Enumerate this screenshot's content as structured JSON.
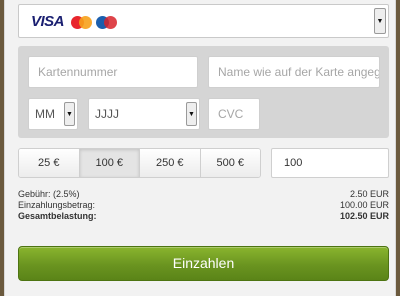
{
  "payment_method": {
    "logos": {
      "visa_text": "VISA",
      "mastercard": "mastercard-logo",
      "maestro": "maestro-logo"
    },
    "arrow_icon": "triangle-down-icon"
  },
  "card_form": {
    "card_number_placeholder": "Kartennummer",
    "card_name_placeholder": "Name wie auf der Karte angegeben",
    "month_value": "MM",
    "year_value": "JJJJ",
    "cvc_placeholder": "CVC",
    "dropdown_arrow_icon": "triangle-down-icon"
  },
  "amounts": {
    "options": [
      "25 €",
      "100 €",
      "250 €",
      "500 €"
    ],
    "selected_index": 1,
    "custom_value": "100"
  },
  "summary": {
    "fee_label": "Gebühr: (2.5%)",
    "fee_value": "2.50 EUR",
    "deposit_label": "Einzahlungsbetrag:",
    "deposit_value": "100.00 EUR",
    "total_label": "Gesamtbelastung:",
    "total_value": "102.50 EUR"
  },
  "pay_button": {
    "label": "Einzahlen"
  },
  "colors": {
    "pay_button_green": "#6a9420",
    "visa_blue": "#1a1f71"
  }
}
